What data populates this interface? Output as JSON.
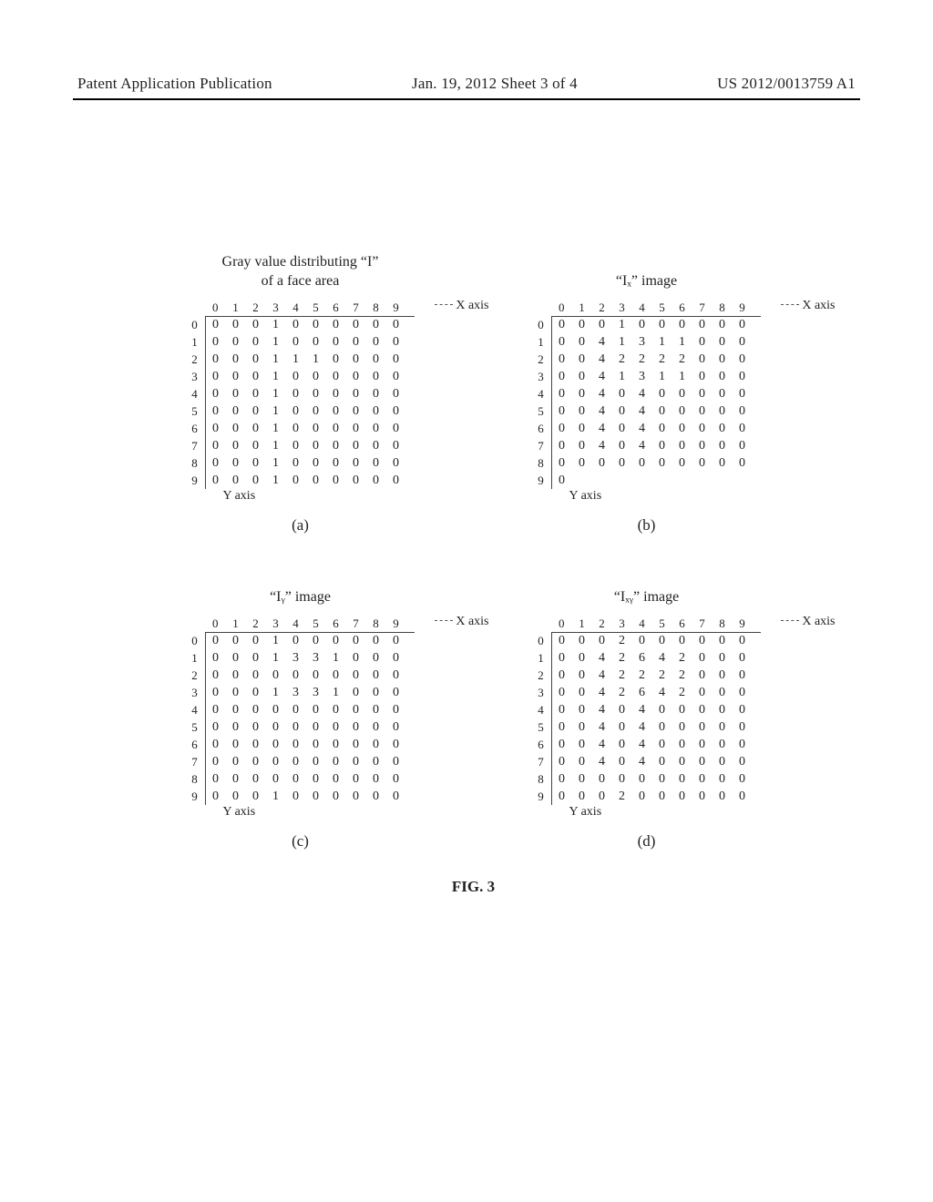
{
  "header": {
    "left": "Patent Application Publication",
    "center": "Jan. 19, 2012  Sheet 3 of 4",
    "right": "US 2012/0013759 A1"
  },
  "title_lines": {
    "l1": "Gray value distributing “I”",
    "l2": "of a face area"
  },
  "row1_titles": {
    "b": "“Iₓ” image"
  },
  "row2_titles": {
    "c": "“Iᵧ” image",
    "d": "“Iₓᵧ” image"
  },
  "captions": {
    "a": "(a)",
    "b": "(b)",
    "c": "(c)",
    "d": "(d)"
  },
  "labels": {
    "x_axis": "X axis",
    "y_axis": "Y axis"
  },
  "col_headers": [
    "0",
    "1",
    "2",
    "3",
    "4",
    "5",
    "6",
    "7",
    "8",
    "9"
  ],
  "row_headers": [
    "0",
    "1",
    "2",
    "3",
    "4",
    "5",
    "6",
    "7",
    "8",
    "9"
  ],
  "chart_data": [
    {
      "id": "a",
      "type": "table",
      "title": "Gray value distributing “I” of a face area",
      "caption": "(a)",
      "xlabel": "X axis",
      "ylabel": "Y axis",
      "col_headers": [
        "0",
        "1",
        "2",
        "3",
        "4",
        "5",
        "6",
        "7",
        "8",
        "9"
      ],
      "row_headers": [
        "0",
        "1",
        "2",
        "3",
        "4",
        "5",
        "6",
        "7",
        "8",
        "9"
      ],
      "values": [
        [
          0,
          0,
          0,
          1,
          0,
          0,
          0,
          0,
          0,
          0
        ],
        [
          0,
          0,
          0,
          1,
          0,
          0,
          0,
          0,
          0,
          0
        ],
        [
          0,
          0,
          0,
          1,
          1,
          1,
          0,
          0,
          0,
          0
        ],
        [
          0,
          0,
          0,
          1,
          0,
          0,
          0,
          0,
          0,
          0
        ],
        [
          0,
          0,
          0,
          1,
          0,
          0,
          0,
          0,
          0,
          0
        ],
        [
          0,
          0,
          0,
          1,
          0,
          0,
          0,
          0,
          0,
          0
        ],
        [
          0,
          0,
          0,
          1,
          0,
          0,
          0,
          0,
          0,
          0
        ],
        [
          0,
          0,
          0,
          1,
          0,
          0,
          0,
          0,
          0,
          0
        ],
        [
          0,
          0,
          0,
          1,
          0,
          0,
          0,
          0,
          0,
          0
        ],
        [
          0,
          0,
          0,
          1,
          0,
          0,
          0,
          0,
          0,
          0
        ]
      ]
    },
    {
      "id": "b",
      "type": "table",
      "title": "“Iₓ” image",
      "caption": "(b)",
      "xlabel": "X axis",
      "ylabel": "Y axis",
      "col_headers": [
        "0",
        "1",
        "2",
        "3",
        "4",
        "5",
        "6",
        "7",
        "8",
        "9"
      ],
      "row_headers": [
        "0",
        "1",
        "2",
        "3",
        "4",
        "5",
        "6",
        "7",
        "8",
        "9"
      ],
      "values": [
        [
          0,
          0,
          0,
          1,
          0,
          0,
          0,
          0,
          0,
          0
        ],
        [
          0,
          0,
          4,
          1,
          3,
          1,
          1,
          0,
          0,
          0
        ],
        [
          0,
          0,
          4,
          2,
          2,
          2,
          2,
          0,
          0,
          0
        ],
        [
          0,
          0,
          4,
          1,
          3,
          1,
          1,
          0,
          0,
          0
        ],
        [
          0,
          0,
          4,
          0,
          4,
          0,
          0,
          0,
          0,
          0
        ],
        [
          0,
          0,
          4,
          0,
          4,
          0,
          0,
          0,
          0,
          0
        ],
        [
          0,
          0,
          4,
          0,
          4,
          0,
          0,
          0,
          0,
          0
        ],
        [
          0,
          0,
          4,
          0,
          4,
          0,
          0,
          0,
          0,
          0
        ],
        [
          0,
          0,
          0,
          0,
          0,
          0,
          0,
          0,
          0,
          0
        ],
        [
          0,
          null,
          null,
          null,
          null,
          null,
          null,
          null,
          null,
          null
        ]
      ]
    },
    {
      "id": "c",
      "type": "table",
      "title": "“Iᵧ” image",
      "caption": "(c)",
      "xlabel": "X axis",
      "ylabel": "Y axis",
      "col_headers": [
        "0",
        "1",
        "2",
        "3",
        "4",
        "5",
        "6",
        "7",
        "8",
        "9"
      ],
      "row_headers": [
        "0",
        "1",
        "2",
        "3",
        "4",
        "5",
        "6",
        "7",
        "8",
        "9"
      ],
      "values": [
        [
          0,
          0,
          0,
          1,
          0,
          0,
          0,
          0,
          0,
          0
        ],
        [
          0,
          0,
          0,
          1,
          3,
          3,
          1,
          0,
          0,
          0
        ],
        [
          0,
          0,
          0,
          0,
          0,
          0,
          0,
          0,
          0,
          0
        ],
        [
          0,
          0,
          0,
          1,
          3,
          3,
          1,
          0,
          0,
          0
        ],
        [
          0,
          0,
          0,
          0,
          0,
          0,
          0,
          0,
          0,
          0
        ],
        [
          0,
          0,
          0,
          0,
          0,
          0,
          0,
          0,
          0,
          0
        ],
        [
          0,
          0,
          0,
          0,
          0,
          0,
          0,
          0,
          0,
          0
        ],
        [
          0,
          0,
          0,
          0,
          0,
          0,
          0,
          0,
          0,
          0
        ],
        [
          0,
          0,
          0,
          0,
          0,
          0,
          0,
          0,
          0,
          0
        ],
        [
          0,
          0,
          0,
          1,
          0,
          0,
          0,
          0,
          0,
          0
        ]
      ]
    },
    {
      "id": "d",
      "type": "table",
      "title": "“Iₓᵧ” image",
      "caption": "(d)",
      "xlabel": "X axis",
      "ylabel": "Y axis",
      "col_headers": [
        "0",
        "1",
        "2",
        "3",
        "4",
        "5",
        "6",
        "7",
        "8",
        "9"
      ],
      "row_headers": [
        "0",
        "1",
        "2",
        "3",
        "4",
        "5",
        "6",
        "7",
        "8",
        "9"
      ],
      "values": [
        [
          0,
          0,
          0,
          2,
          0,
          0,
          0,
          0,
          0,
          0
        ],
        [
          0,
          0,
          4,
          2,
          6,
          4,
          2,
          0,
          0,
          0
        ],
        [
          0,
          0,
          4,
          2,
          2,
          2,
          2,
          0,
          0,
          0
        ],
        [
          0,
          0,
          4,
          2,
          6,
          4,
          2,
          0,
          0,
          0
        ],
        [
          0,
          0,
          4,
          0,
          4,
          0,
          0,
          0,
          0,
          0
        ],
        [
          0,
          0,
          4,
          0,
          4,
          0,
          0,
          0,
          0,
          0
        ],
        [
          0,
          0,
          4,
          0,
          4,
          0,
          0,
          0,
          0,
          0
        ],
        [
          0,
          0,
          4,
          0,
          4,
          0,
          0,
          0,
          0,
          0
        ],
        [
          0,
          0,
          0,
          0,
          0,
          0,
          0,
          0,
          0,
          0
        ],
        [
          0,
          0,
          0,
          2,
          0,
          0,
          0,
          0,
          0,
          0
        ]
      ]
    }
  ],
  "figure_caption": "FIG. 3"
}
